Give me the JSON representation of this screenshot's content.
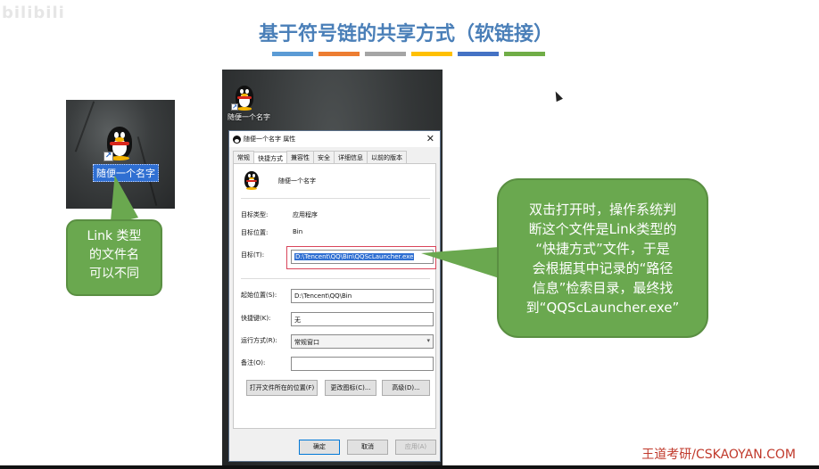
{
  "watermark": "bilibili",
  "slide": {
    "title": "基于符号链的共享方式（软链接）",
    "bar_colors": [
      "#5b9bd5",
      "#ed7d31",
      "#a5a5a5",
      "#ffc000",
      "#4472c4",
      "#70ad47"
    ]
  },
  "desktop_small": {
    "icon_label": "随便一个名字"
  },
  "callout_left": {
    "lines": [
      "Link 类型",
      "的文件名",
      "可以不同"
    ]
  },
  "desktop_big": {
    "icon_label": "随便一个名字"
  },
  "dialog": {
    "title": "随便一个名字 属性",
    "close": "✕",
    "tabs": [
      "常规",
      "快捷方式",
      "兼容性",
      "安全",
      "详细信息",
      "以前的版本"
    ],
    "active_tab": "快捷方式",
    "name": "随便一个名字",
    "target_type_label": "目标类型:",
    "target_type_value": "应用程序",
    "target_location_label": "目标位置:",
    "target_location_value": "Bin",
    "target_label": "目标(T):",
    "target_value": "D:\\Tencent\\QQ\\Bin\\QQScLauncher.exe",
    "start_in_label": "起始位置(S):",
    "start_in_value": "D:\\Tencent\\QQ\\Bin",
    "hotkey_label": "快捷键(K):",
    "hotkey_value": "无",
    "run_label": "运行方式(R):",
    "run_value": "常规窗口",
    "comment_label": "备注(O):",
    "comment_value": "",
    "open_location_btn": "打开文件所在的位置(F)",
    "change_icon_btn": "更改图标(C)...",
    "advanced_btn": "高级(D)...",
    "ok_btn": "确定",
    "cancel_btn": "取消",
    "apply_btn": "应用(A)"
  },
  "callout_right": {
    "lines": [
      "双击打开时，操作系统判",
      "断这个文件是Link类型的",
      "“快捷方式”文件，于是",
      "会根据其中记录的“路径",
      "信息”检索目录，最终找",
      "到“QQScLauncher.exe”"
    ]
  },
  "footer": "王道考研/CSKAOYAN.COM"
}
